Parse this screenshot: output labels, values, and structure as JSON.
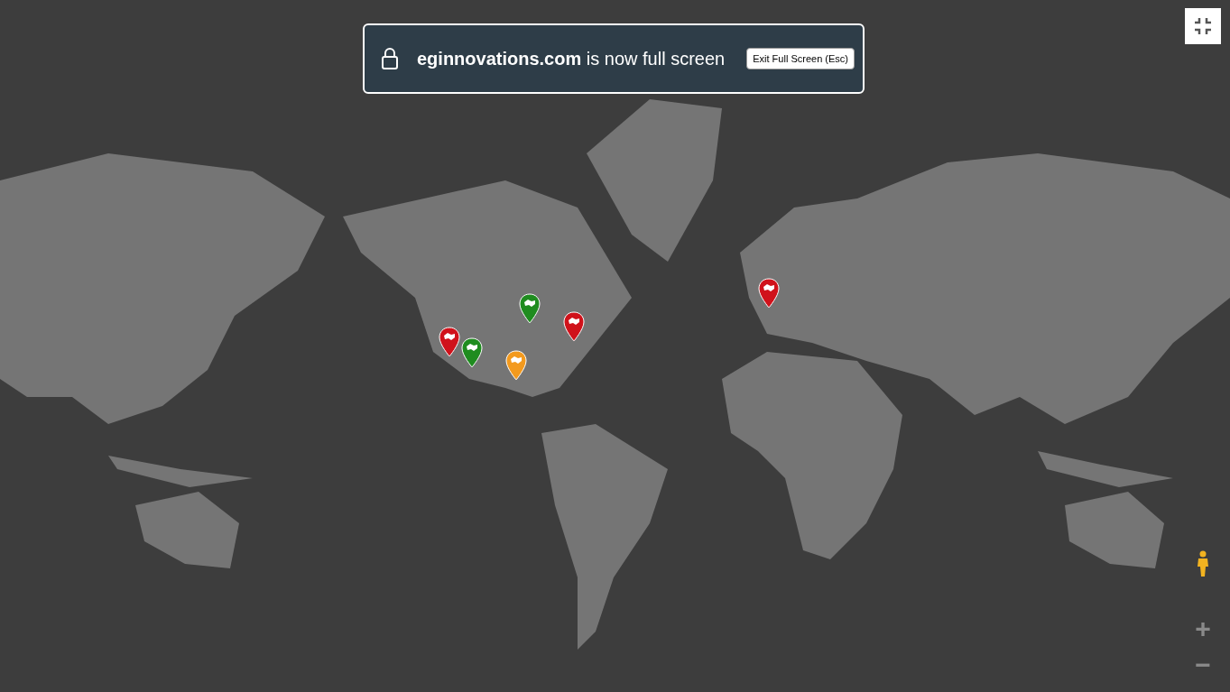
{
  "fullscreen_notice": {
    "message": "**eginnovations.com** is now full screen",
    "button": "Exit Full Screen (Esc)"
  },
  "markers": [
    {
      "color": "#d0121b"
    },
    {
      "color": "#1f8c1f"
    },
    {
      "color": "#1f8c1f"
    },
    {
      "color": "#d0121b"
    },
    {
      "color": "#f39a1e"
    },
    {
      "color": "#d0121b"
    }
  ],
  "zoom": {
    "zoom_in": "+",
    "zoom_out": "−"
  }
}
